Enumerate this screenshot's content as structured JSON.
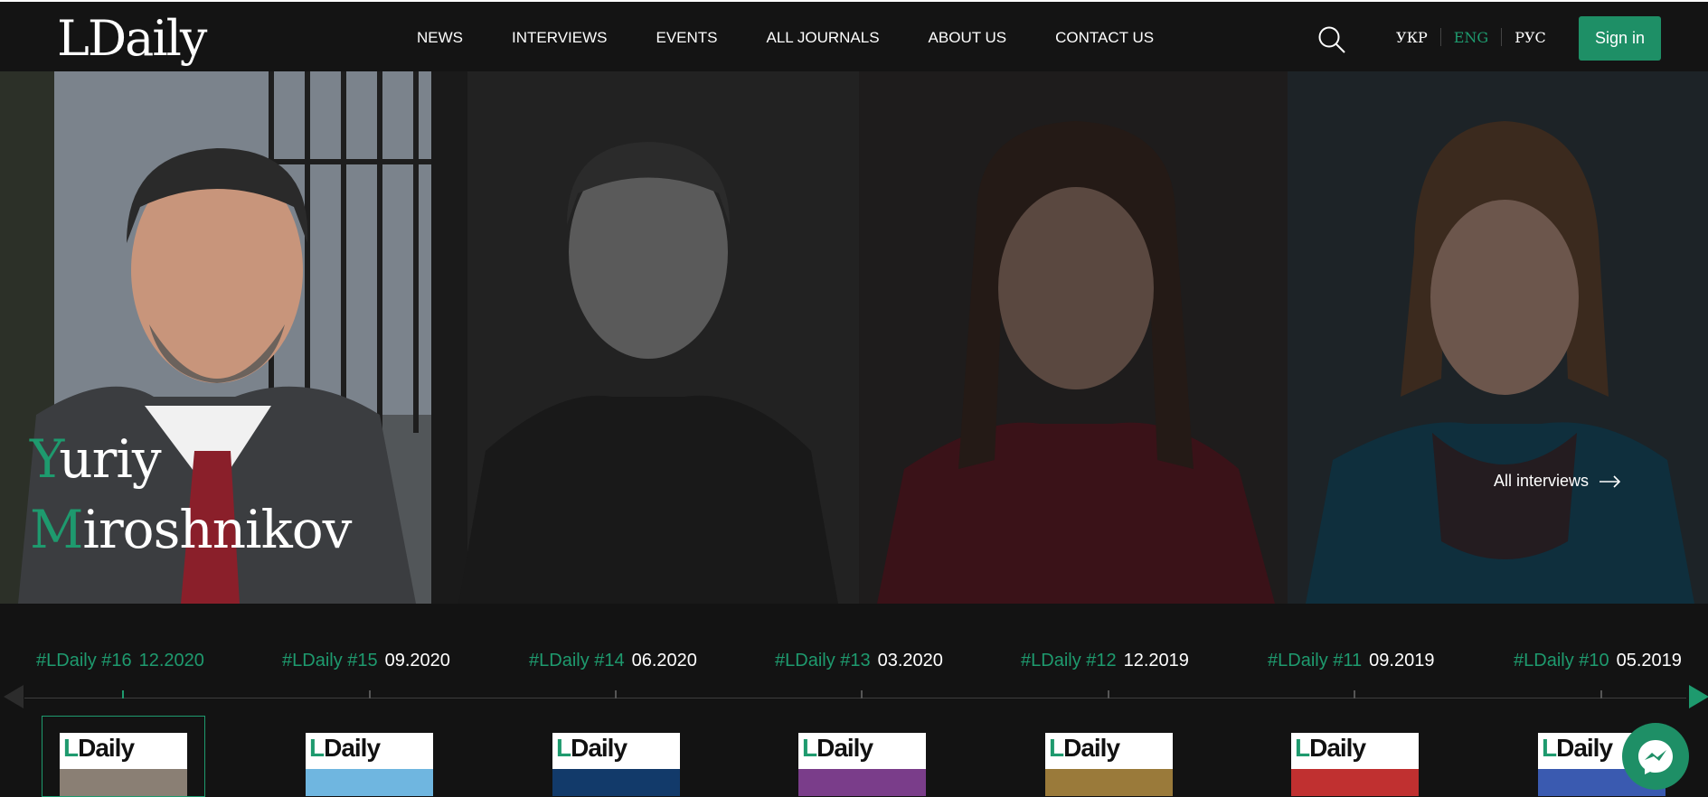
{
  "header": {
    "logo": "LDaily",
    "nav": [
      "NEWS",
      "INTERVIEWS",
      "EVENTS",
      "ALL JOURNALS",
      "ABOUT US",
      "CONTACT US"
    ],
    "languages": [
      "УКР",
      "ENG",
      "РУС"
    ],
    "active_language": "ENG",
    "sign_in": "Sign in"
  },
  "hero": {
    "name_first_initial": "Y",
    "name_first_rest": "uriy",
    "name_last_initial": "M",
    "name_last_rest": "iroshnikov",
    "all_interviews": "All interviews"
  },
  "issues": [
    {
      "num": "#LDaily #16",
      "date": "12.2020",
      "active": true,
      "cover_color": "#8a7f74"
    },
    {
      "num": "#LDaily #15",
      "date": "09.2020",
      "active": false,
      "cover_color": "#6fb6e0"
    },
    {
      "num": "#LDaily #14",
      "date": "06.2020",
      "active": false,
      "cover_color": "#123a6a"
    },
    {
      "num": "#LDaily #13",
      "date": "03.2020",
      "active": false,
      "cover_color": "#7a3d8a"
    },
    {
      "num": "#LDaily #12",
      "date": "12.2019",
      "active": false,
      "cover_color": "#9a7a3a"
    },
    {
      "num": "#LDaily #11",
      "date": "09.2019",
      "active": false,
      "cover_color": "#c03030"
    },
    {
      "num": "#LDaily #10",
      "date": "05.2019",
      "active": false,
      "cover_color": "#3a5ab0"
    }
  ],
  "colors": {
    "accent": "#1e9a6e",
    "background": "#131313"
  }
}
